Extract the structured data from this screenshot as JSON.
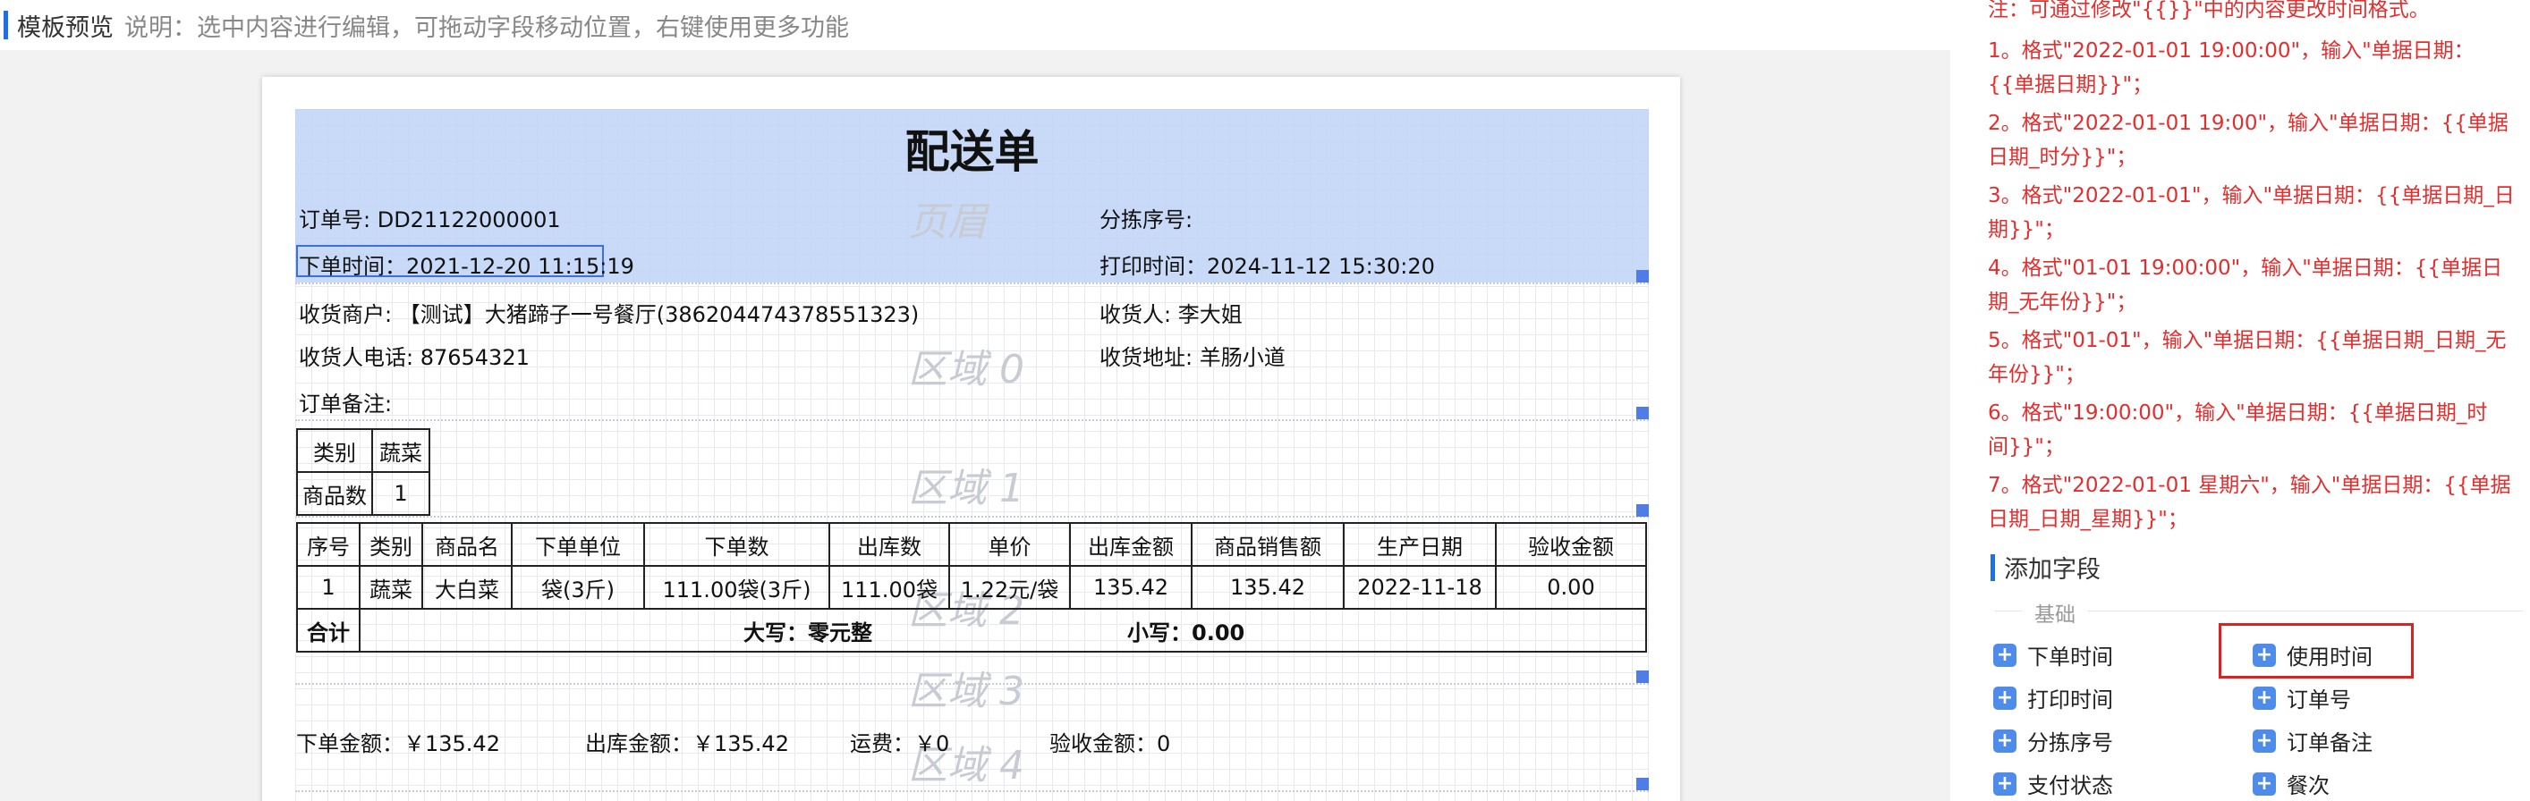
{
  "header": {
    "title": "模板预览",
    "description": "说明：选中内容进行编辑，可拖动字段移动位置，右键使用更多功能"
  },
  "document": {
    "title": "配送单",
    "regions": {
      "header": "页眉",
      "region0": "区域 0",
      "region1": "区域 1",
      "region2": "区域 2",
      "region3": "区域 3",
      "region4": "区域 4"
    },
    "order_no": "订单号: DD21122000001",
    "sort_no": "分拣序号:",
    "order_time": "下单时间：2021-12-20 11:15:19",
    "print_time": "打印时间：2024-11-12 15:30:20",
    "merchant": "收货商户: 【测试】大猪蹄子一号餐厅(386204474378551323)",
    "receiver": "收货人: 李大姐",
    "phone": "收货人电话: 87654321",
    "address": "收货地址: 羊肠小道",
    "remark": "订单备注:",
    "category_table": {
      "rows": [
        [
          "类别",
          "蔬菜"
        ],
        [
          "商品数",
          "1"
        ]
      ]
    },
    "items_table": {
      "headers": [
        "序号",
        "类别",
        "商品名",
        "下单单位",
        "下单数",
        "出库数",
        "单价",
        "出库金额",
        "商品销售额",
        "生产日期",
        "验收金额"
      ],
      "rows": [
        [
          "1",
          "蔬菜",
          "大白菜",
          "袋(3斤)",
          "111.00袋(3斤)",
          "111.00袋",
          "1.22元/袋",
          "135.42",
          "135.42",
          "2022-11-18",
          "0.00"
        ]
      ],
      "total_label": "合计",
      "total_upper": "大写：零元整",
      "total_lower": "小写：0.00"
    },
    "footer": {
      "order_amount": "下单金额：￥135.42",
      "outbound_amount": "出库金额：￥135.42",
      "freight": "运费：￥0",
      "acceptance_amount": "验收金额：0"
    }
  },
  "panel": {
    "notes": [
      "注：可通过修改\"{{}}\"中的内容更改时间格式。",
      "1。格式\"2022-01-01 19:00:00\"，输入\"单据日期：{{单据日期}}\"；",
      "2。格式\"2022-01-01 19:00\"，输入\"单据日期：{{单据日期_时分}}\"；",
      "3。格式\"2022-01-01\"，输入\"单据日期：{{单据日期_日期}}\"；",
      "4。格式\"01-01 19:00:00\"，输入\"单据日期：{{单据日期_无年份}}\"；",
      "5。格式\"01-01\"，输入\"单据日期：{{单据日期_日期_无年份}}\"；",
      "6。格式\"19:00:00\"，输入\"单据日期：{{单据日期_时间}}\"；",
      "7。格式\"2022-01-01 星期六\"，输入\"单据日期：{{单据日期_日期_星期}}\"；"
    ],
    "add_field_title": "添加字段",
    "basic_label": "基础",
    "fields": [
      "下单时间",
      "使用时间",
      "打印时间",
      "订单号",
      "分拣序号",
      "订单备注",
      "支付状态",
      "餐次"
    ],
    "plus_icon": "+",
    "accent_color": "#1f6fe5",
    "note_color": "#e42d2d"
  }
}
